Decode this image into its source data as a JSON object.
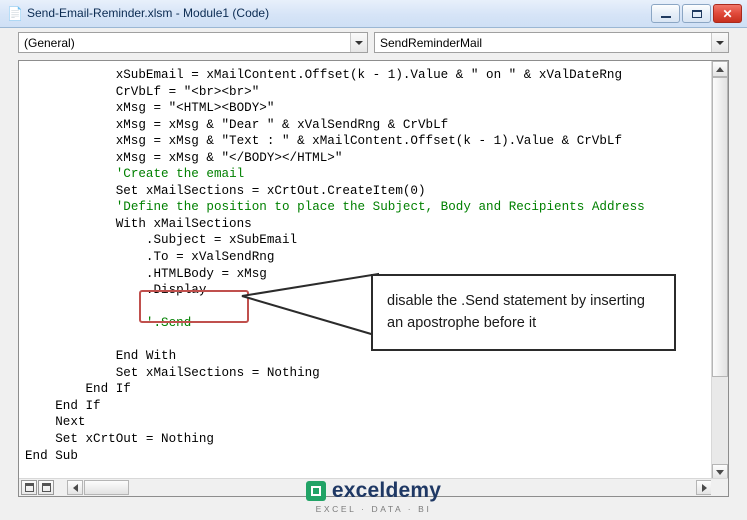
{
  "window": {
    "title": "Send-Email-Reminder.xlsm - Module1 (Code)",
    "icon": "vba-module-icon",
    "buttons": {
      "minimize": "minimize-icon",
      "maximize": "maximize-icon",
      "close": "✕"
    }
  },
  "toolbar": {
    "object_combo": {
      "value": "(General)",
      "arrow": "chevron-down-icon"
    },
    "procedure_combo": {
      "value": "SendReminderMail",
      "arrow": "chevron-down-icon"
    }
  },
  "code": {
    "lines": [
      "            xSubEmail = xMailContent.Offset(k - 1).Value & \" on \" & xValDateRng",
      "            CrVbLf = \"<br><br>\"",
      "            xMsg = \"<HTML><BODY>\"",
      "            xMsg = xMsg & \"Dear \" & xValSendRng & CrVbLf",
      "            xMsg = xMsg & \"Text : \" & xMailContent.Offset(k - 1).Value & CrVbLf",
      "            xMsg = xMsg & \"</BODY></HTML>\"",
      "            'Create the email",
      "            Set xMailSections = xCrtOut.CreateItem(0)",
      "            'Define the position to place the Subject, Body and Recipients Address",
      "            With xMailSections",
      "                .Subject = xSubEmail",
      "                .To = xValSendRng",
      "                .HTMLBody = xMsg",
      "                .Display",
      "",
      "                '.Send",
      "",
      "            End With",
      "            Set xMailSections = Nothing",
      "        End If",
      "    End If",
      "    Next",
      "    Set xCrtOut = Nothing",
      "End Sub"
    ]
  },
  "annotation": {
    "highlighted_code": "'.Send",
    "callout_text": "disable the .Send statement by inserting an apostrophe before it",
    "highlight_color": "#c0504d",
    "callout_border_color": "#2b2b2b"
  },
  "scrollbars": {
    "vertical": {
      "up_arrow": "scroll-up-icon",
      "down_arrow": "scroll-down-icon"
    },
    "horizontal": {
      "left_arrow": "scroll-left-icon",
      "right_arrow": "scroll-right-icon"
    }
  },
  "view_buttons": {
    "procedure_view": "procedure-view-icon",
    "full_module_view": "full-module-view-icon"
  },
  "watermark": {
    "brand_first": "exceldemy",
    "brand_accent": "d",
    "tagline": "EXCEL · DATA · BI"
  }
}
